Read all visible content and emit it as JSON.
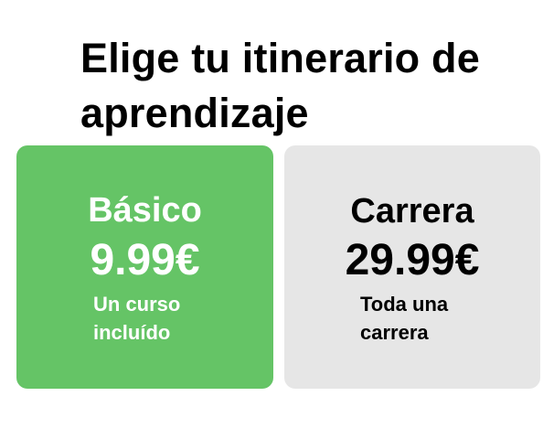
{
  "header": {
    "title": "Elige tu itinerario de aprendizaje"
  },
  "plans": [
    {
      "name": "Básico",
      "price": "9.99€",
      "description": "Un curso incluído"
    },
    {
      "name": "Carrera",
      "price": "29.99€",
      "description": "Toda una carrera"
    }
  ],
  "colors": {
    "basic_card_bg": "#65c466",
    "basic_card_text": "#ffffff",
    "career_card_bg": "#e6e6e6",
    "career_card_text": "#000000",
    "title_text": "#000000"
  }
}
